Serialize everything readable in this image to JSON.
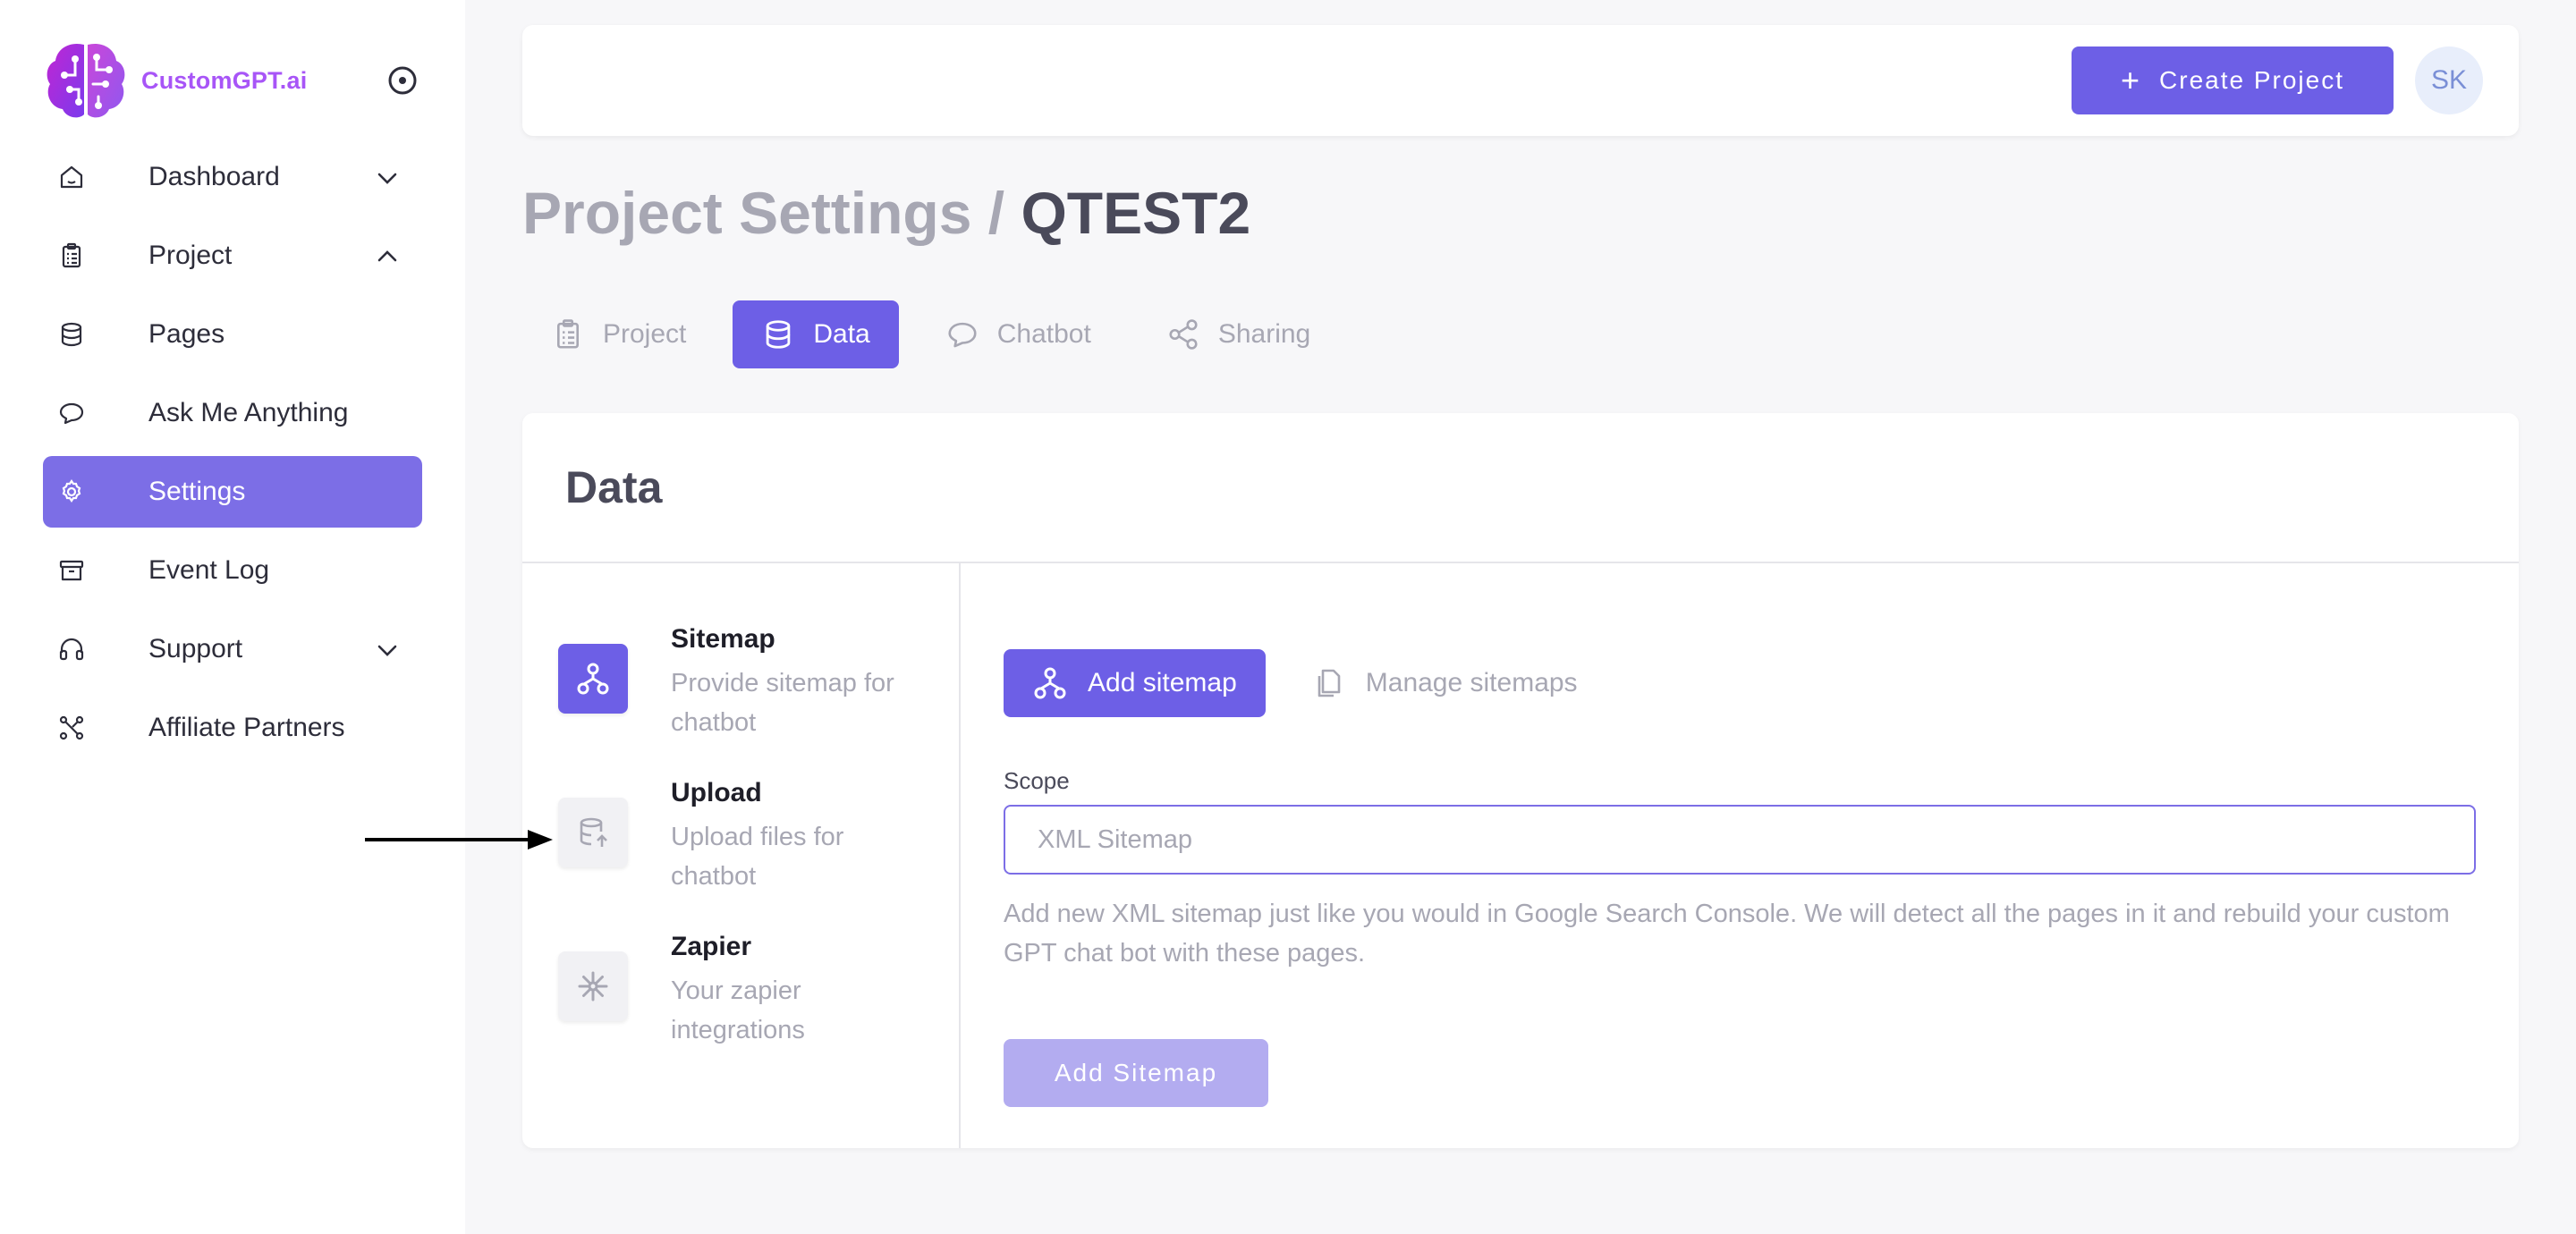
{
  "brand": {
    "name": "CustomGPT.ai"
  },
  "sidebar": {
    "items": [
      {
        "label": "Dashboard",
        "icon": "home-icon",
        "chevron": "down"
      },
      {
        "label": "Project",
        "icon": "clipboard-icon",
        "chevron": "up"
      },
      {
        "label": "Pages",
        "icon": "database-icon"
      },
      {
        "label": "Ask Me Anything",
        "icon": "chat-bubble-icon"
      },
      {
        "label": "Settings",
        "icon": "gear-icon",
        "active": true
      },
      {
        "label": "Event Log",
        "icon": "archive-icon"
      },
      {
        "label": "Support",
        "icon": "headphones-icon",
        "chevron": "down"
      },
      {
        "label": "Affiliate Partners",
        "icon": "network-icon"
      }
    ]
  },
  "header": {
    "create_label": "Create Project",
    "avatar_initials": "SK"
  },
  "page": {
    "title_prefix": "Project Settings /",
    "title_project": "QTEST2"
  },
  "tabs": [
    {
      "label": "Project",
      "icon": "clipboard-icon"
    },
    {
      "label": "Data",
      "icon": "database-icon",
      "active": true
    },
    {
      "label": "Chatbot",
      "icon": "chat-bubble-icon"
    },
    {
      "label": "Sharing",
      "icon": "share-icon"
    }
  ],
  "data_card": {
    "title": "Data",
    "sources": [
      {
        "title": "Sitemap",
        "description": "Provide sitemap for chatbot",
        "icon": "sitemap-icon",
        "active": true
      },
      {
        "title": "Upload",
        "description": "Upload files for chatbot",
        "icon": "upload-database-icon"
      },
      {
        "title": "Zapier",
        "description": "Your zapier integrations",
        "icon": "zapier-icon"
      }
    ],
    "subtabs": [
      {
        "label": "Add sitemap",
        "icon": "sitemap-icon",
        "active": true
      },
      {
        "label": "Manage sitemaps",
        "icon": "copy-icon"
      }
    ],
    "scope": {
      "label": "Scope",
      "value": "",
      "placeholder": "XML Sitemap",
      "help": "Add new XML sitemap just like you would in Google Search Console. We will detect all the pages in it and rebuild your custom GPT chat bot with these pages."
    },
    "submit_label": "Add Sitemap"
  },
  "colors": {
    "accent": "#6d5fe6",
    "sidebar_active": "#7c6ee6",
    "brand_text": "#a855f7",
    "muted_text": "#a7a7b3",
    "disabled_button": "#b3acf0"
  }
}
